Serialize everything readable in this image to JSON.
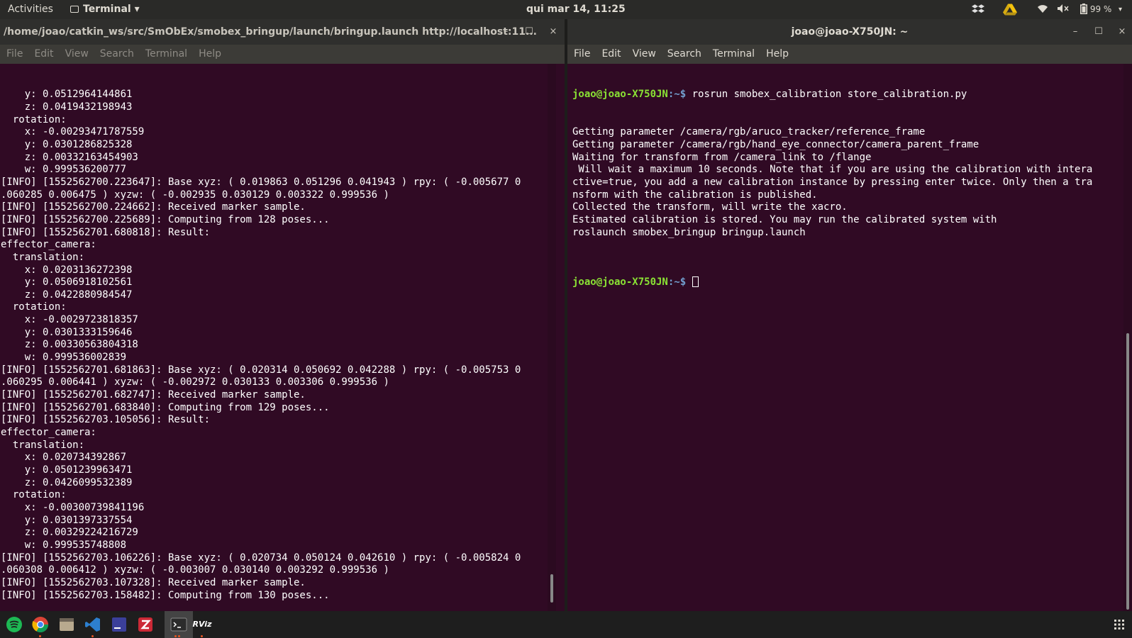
{
  "topbar": {
    "activities": "Activities",
    "app_menu": "Terminal",
    "app_menu_arrow": "▾",
    "clock": "qui mar 14, 11:25",
    "battery_text": "99 %",
    "menu_arrow": "▾"
  },
  "left_window": {
    "title": "/home/joao/catkin_ws/src/SmObEx/smobex_bringup/launch/bringup.launch http://localhost:11...",
    "minimize": "–",
    "maximize": "☐",
    "close": "×",
    "menu": [
      "File",
      "Edit",
      "View",
      "Search",
      "Terminal",
      "Help"
    ],
    "lines": [
      "    y: 0.0512964144861",
      "    z: 0.0419432198943",
      "  rotation:",
      "    x: -0.00293471787559",
      "    y: 0.0301286825328",
      "    z: 0.00332163454903",
      "    w: 0.999536200777",
      "[INFO] [1552562700.223647]: Base xyz: ( 0.019863 0.051296 0.041943 ) rpy: ( -0.005677 0",
      ".060285 0.006475 ) xyzw: ( -0.002935 0.030129 0.003322 0.999536 )",
      "[INFO] [1552562700.224662]: Received marker sample.",
      "[INFO] [1552562700.225689]: Computing from 128 poses...",
      "[INFO] [1552562701.680818]: Result:",
      "effector_camera:",
      "  translation:",
      "    x: 0.0203136272398",
      "    y: 0.0506918102561",
      "    z: 0.0422880984547",
      "  rotation:",
      "    x: -0.0029723818357",
      "    y: 0.0301333159646",
      "    z: 0.00330563804318",
      "    w: 0.999536002839",
      "[INFO] [1552562701.681863]: Base xyz: ( 0.020314 0.050692 0.042288 ) rpy: ( -0.005753 0",
      ".060295 0.006441 ) xyzw: ( -0.002972 0.030133 0.003306 0.999536 )",
      "[INFO] [1552562701.682747]: Received marker sample.",
      "[INFO] [1552562701.683840]: Computing from 129 poses...",
      "[INFO] [1552562703.105056]: Result:",
      "effector_camera:",
      "  translation:",
      "    x: 0.020734392867",
      "    y: 0.0501239963471",
      "    z: 0.0426099532389",
      "  rotation:",
      "    x: -0.00300739841196",
      "    y: 0.0301397337554",
      "    z: 0.00329224216729",
      "    w: 0.999535748808",
      "[INFO] [1552562703.106226]: Base xyz: ( 0.020734 0.050124 0.042610 ) rpy: ( -0.005824 0",
      ".060308 0.006412 ) xyzw: ( -0.003007 0.030140 0.003292 0.999536 )",
      "[INFO] [1552562703.107328]: Received marker sample.",
      "[INFO] [1552562703.158482]: Computing from 130 poses..."
    ]
  },
  "right_window": {
    "title": "joao@joao-X750JN: ~",
    "minimize": "–",
    "maximize": "☐",
    "close": "×",
    "menu": [
      "File",
      "Edit",
      "View",
      "Search",
      "Terminal",
      "Help"
    ],
    "prompt_user": "joao@joao-X750JN",
    "prompt_path": ":~$",
    "command": " rosrun smobex_calibration store_calibration.py",
    "output": [
      "Getting parameter /camera/rgb/aruco_tracker/reference_frame",
      "Getting parameter /camera/rgb/hand_eye_connector/camera_parent_frame",
      "Waiting for transform from /camera_link to /flange",
      " Will wait a maximum 10 seconds. Note that if you are using the calibration with intera",
      "ctive=true, you add a new calibration instance by pressing enter twice. Only then a tra",
      "nsform with the calibration is published.",
      "Collected the transform, will write the xacro.",
      "Estimated calibration is stored. You may run the calibrated system with",
      "roslaunch smobex_bringup bringup.launch",
      ""
    ]
  },
  "dock": {
    "icons": [
      "spotify-icon",
      "chrome-icon",
      "files-icon",
      "vscode-icon",
      "ide-icon",
      "zotero-icon",
      "terminal-icon",
      "rviz-icon"
    ],
    "rviz_label": "RViz",
    "colors": {
      "spotify": "#1db954",
      "chrome": "#db4437",
      "files": "#b8a98e",
      "vscode": "#2d7fcf",
      "ide": "#3b3f9a",
      "zotero": "#cc2936",
      "terminal": "#2c2c2c"
    }
  },
  "colors": {
    "terminal_bg": "#300a24",
    "prompt_user": "#8ae234",
    "prompt_path": "#729fcf",
    "accent": "#e95420"
  }
}
